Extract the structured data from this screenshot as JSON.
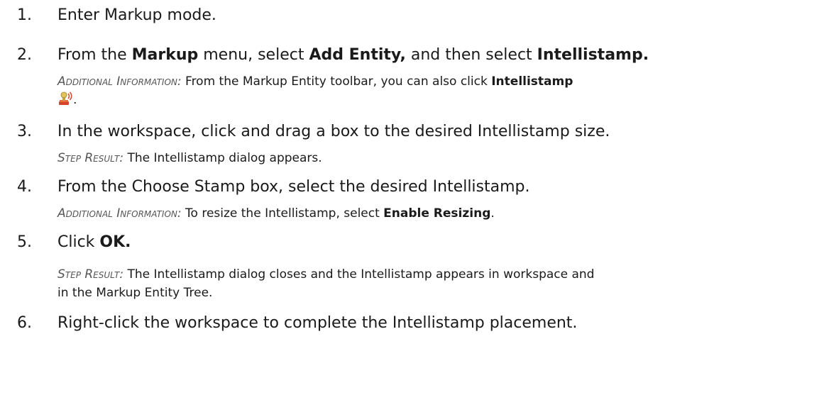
{
  "steps": [
    {
      "number": "1.",
      "text": "Enter Markup mode."
    },
    {
      "number": "2.",
      "t1": "From the ",
      "b1": "Markup",
      "t2": " menu, select ",
      "b2": "Add Entity,",
      "t3": " and then select ",
      "b3": "Intellistamp.",
      "info_label": "Additional Information:",
      "info_t1": " From the Markup Entity toolbar, you can also click ",
      "info_b1": "Intellistamp",
      "info_icon": "intellistamp-icon",
      "info_t2": "."
    },
    {
      "number": "3.",
      "text": "In the workspace, click and drag a box to the desired Intellistamp size.",
      "info_label": "Step Result:",
      "info_t1": " The Intellistamp dialog appears."
    },
    {
      "number": "4.",
      "text": "From the Choose Stamp box, select the desired Intellistamp.",
      "info_label": "Additional Information:",
      "info_t1": " To resize the Intellistamp, select ",
      "info_b1": "Enable Resizing",
      "info_t2": "."
    },
    {
      "number": "5.",
      "t1": "Click ",
      "b1": "OK.",
      "info_label": "Step Result:",
      "info_line1": " The Intellistamp dialog closes and the Intellistamp appears in workspace and",
      "info_line2": "in the Markup Entity Tree."
    },
    {
      "number": "6.",
      "text": "Right-click the workspace to complete the Intellistamp placement."
    }
  ]
}
